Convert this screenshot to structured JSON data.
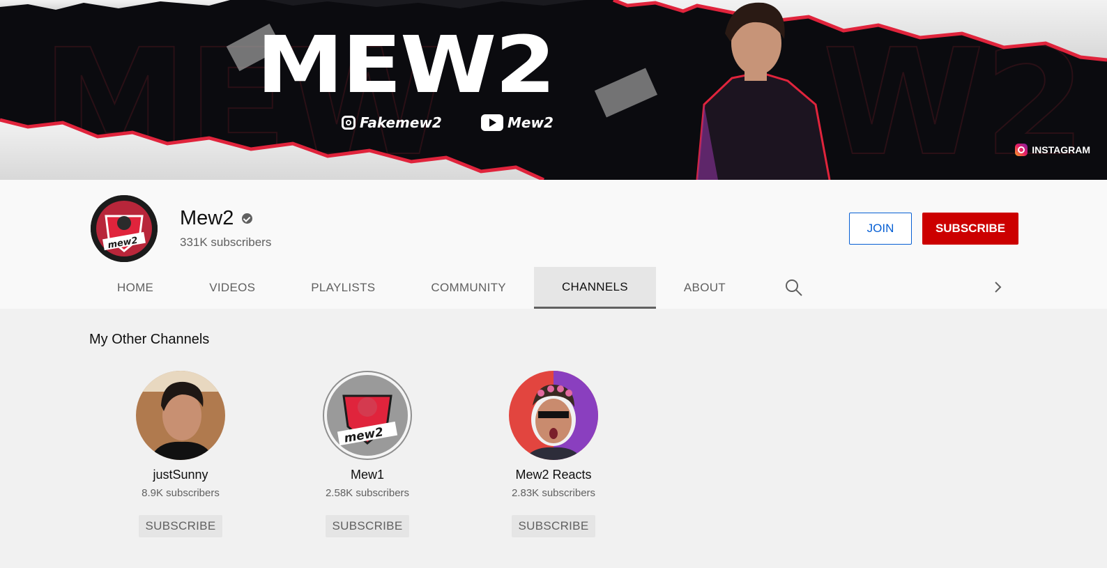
{
  "banner": {
    "title": "MEW2",
    "instagram_handle": "Fakemew2",
    "youtube_handle": "Mew2",
    "link_label": "INSTAGRAM",
    "colors": {
      "accent": "#e0243c",
      "background": "#0b0b0f",
      "paper": "#e7e7e7"
    }
  },
  "channel": {
    "name": "Mew2",
    "verified_icon": "verified-check-icon",
    "subscribers": "331K subscribers",
    "join_label": "JOIN",
    "subscribe_label": "SUBSCRIBE",
    "subscribe_color": "#cc0000",
    "join_color": "#065fd4"
  },
  "tabs": [
    {
      "label": "HOME"
    },
    {
      "label": "VIDEOS"
    },
    {
      "label": "PLAYLISTS"
    },
    {
      "label": "COMMUNITY"
    },
    {
      "label": "CHANNELS",
      "active": true
    },
    {
      "label": "ABOUT"
    }
  ],
  "tab_icons": {
    "search": "search-icon",
    "next": "chevron-right-icon"
  },
  "section": {
    "title": "My Other Channels",
    "channels": [
      {
        "name": "justSunny",
        "subscribers": "8.9K subscribers",
        "button": "SUBSCRIBE"
      },
      {
        "name": "Mew1",
        "subscribers": "2.58K subscribers",
        "button": "SUBSCRIBE"
      },
      {
        "name": "Mew2 Reacts",
        "subscribers": "2.83K subscribers",
        "button": "SUBSCRIBE"
      }
    ]
  }
}
